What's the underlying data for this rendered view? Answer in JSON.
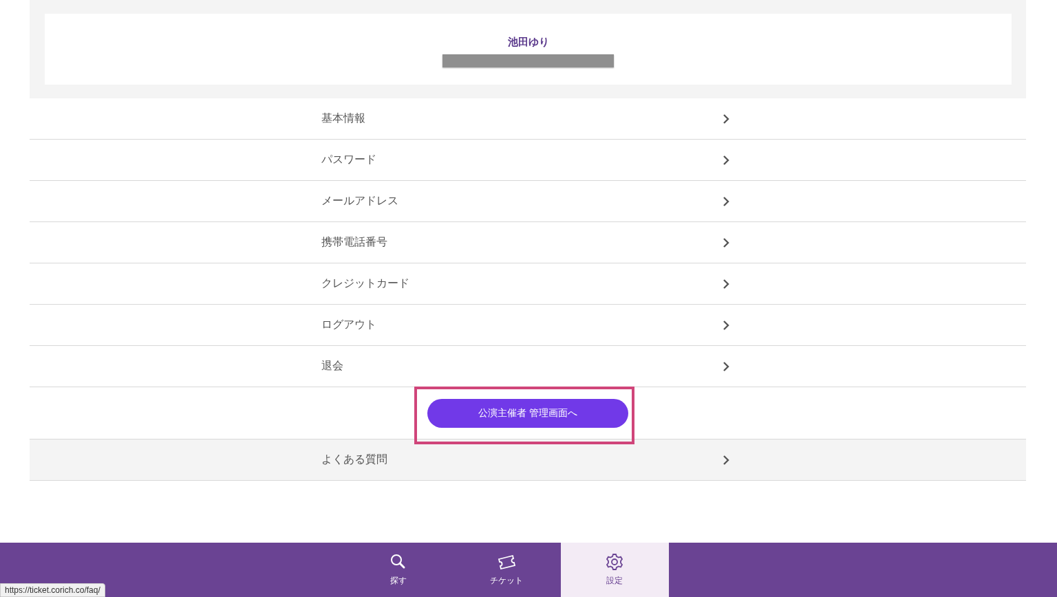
{
  "profile": {
    "name": "池田ゆり",
    "redacted": true
  },
  "menu": [
    {
      "label": "基本情報"
    },
    {
      "label": "パスワード"
    },
    {
      "label": "メールアドレス"
    },
    {
      "label": "携帯電話番号"
    },
    {
      "label": "クレジットカード"
    },
    {
      "label": "ログアウト"
    },
    {
      "label": "退会"
    }
  ],
  "admin_button": {
    "label": "公演主催者 管理画面へ",
    "highlighted": true
  },
  "faq": {
    "label": "よくある質問"
  },
  "tabs": [
    {
      "label": "探す",
      "kind": "search",
      "selected": false
    },
    {
      "label": "チケット",
      "kind": "ticket",
      "selected": false
    },
    {
      "label": "設定",
      "kind": "settings",
      "selected": true
    }
  ],
  "status_url": "https://ticket.corich.co/faq/"
}
